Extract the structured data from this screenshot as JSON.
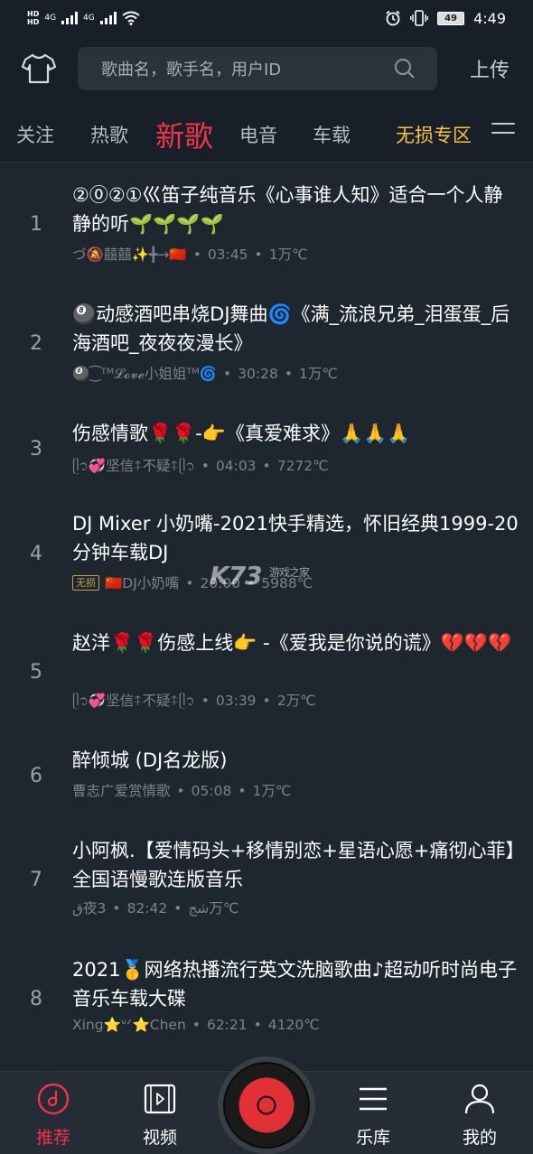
{
  "status_bar": {
    "left_badges": [
      "HD",
      "HD"
    ],
    "network_1": "4G",
    "network_2": "4G",
    "battery": "49",
    "time": "4:49"
  },
  "header": {
    "search_placeholder": "歌曲名，歌手名，用户ID",
    "upload_label": "上传"
  },
  "tabs": [
    {
      "label": "关注"
    },
    {
      "label": "热歌"
    },
    {
      "label": "新歌"
    },
    {
      "label": "电音"
    },
    {
      "label": "车载"
    },
    {
      "label": "无损专区"
    }
  ],
  "songs": [
    {
      "rank": "1",
      "title": "②⓪②①巛笛子纯音乐《心事谁人知》适合一个人静静的听🌱🌱🌱🌱",
      "uploader": "づ🔕囍囍✨╋→🇨🇳",
      "duration": "03:45",
      "heat": "1万℃"
    },
    {
      "rank": "2",
      "title": "🎱动感酒吧串烧DJ舞曲🌀《满_流浪兄弟_泪蛋蛋_后海酒吧_夜夜夜漫长》",
      "uploader": "🎱⁐ᵀᴹ𝓛𝓸𝓿𝓮小姐姐ᵀᴹ🌀",
      "duration": "30:28",
      "heat": "1万℃"
    },
    {
      "rank": "3",
      "title": "伤感情歌🌹🌹-👉《真爱难求》🙏🙏🙏",
      "uploader": "ᥫ᭡💞坚信⍏不疑⍏ᥫ᭡",
      "duration": "04:03",
      "heat": "7272℃"
    },
    {
      "rank": "4",
      "title": "DJ Mixer 小奶嘴-2021快手精选，怀旧经典1999-20分钟车载DJ",
      "badge": "无损",
      "uploader": "🇨🇳DJ小奶嘴",
      "duration": "20:00",
      "heat": "5988℃"
    },
    {
      "rank": "5",
      "title": "赵洋🌹🌹伤感上线👉 -《爱我是你说的谎》💔💔💔",
      "uploader": "ᥫ᭡💞坚信⍏不疑⍏ᥫ᭡",
      "duration": "03:39",
      "heat": "2万℃"
    },
    {
      "rank": "6",
      "title": "醉倾城 (DJ名龙版)",
      "uploader": "曹志广爱赏情歌",
      "duration": "05:08",
      "heat": "1万℃"
    },
    {
      "rank": "7",
      "title": "小阿枫.【爱情码头+移情别恋+星语心愿+痛彻心菲】全国语慢歌连版音乐",
      "uploader": "ﻕ夜ﺷﺞ",
      "duration": "82:42",
      "heat": "3万℃"
    },
    {
      "rank": "8",
      "title": "2021🥇网络热播流行英文洗脑歌曲♪超动听时尚电子音乐车载大碟",
      "uploader": "Xing⭐ᐡᐟ⭐Chen",
      "duration": "62:21",
      "heat": "4120℃"
    }
  ],
  "watermark": {
    "logo": "K73",
    "sub": "游戏之家",
    "domain": ".com"
  },
  "bottom_nav": [
    {
      "label": "推荐",
      "icon": "disc-icon"
    },
    {
      "label": "视频",
      "icon": "video-icon"
    },
    {
      "label": "乐库",
      "icon": "list-icon"
    },
    {
      "label": "我的",
      "icon": "user-icon"
    }
  ],
  "colors": {
    "accent": "#f0344a",
    "gold": "#f6c343",
    "background": "#1e2630"
  }
}
